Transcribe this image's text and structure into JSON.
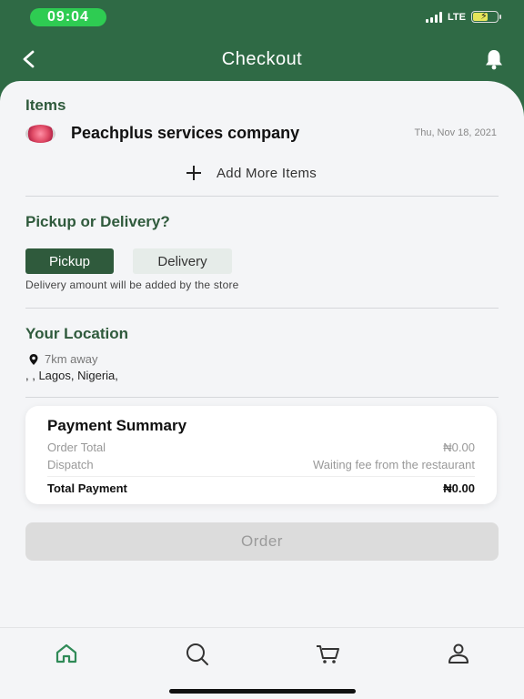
{
  "status_bar": {
    "time": "09:04",
    "network": "LTE"
  },
  "header": {
    "title": "Checkout",
    "back_icon": "chevron-left-icon",
    "bell_icon": "bell-icon"
  },
  "items_section": {
    "title": "Items",
    "company_name": "Peachplus services company",
    "date": "Thu, Nov 18, 2021",
    "add_more_label": "Add More Items"
  },
  "pickup_section": {
    "title": "Pickup or Delivery?",
    "pickup_label": "Pickup",
    "delivery_label": "Delivery",
    "selected": "Pickup",
    "note": "Delivery amount will be added by the store"
  },
  "location_section": {
    "title": "Your Location",
    "distance": "7km away",
    "address": ", , Lagos, Nigeria,"
  },
  "payment_summary": {
    "title": "Payment Summary",
    "order_total_label": "Order Total",
    "order_total_value": "₦0.00",
    "dispatch_label": "Dispatch",
    "dispatch_value": "Waiting fee from the restaurant",
    "total_label": "Total Payment",
    "total_value": "₦0.00"
  },
  "order_button": {
    "label": "Order",
    "state": "disabled"
  },
  "bottom_nav": {
    "items": [
      "home-icon",
      "search-icon",
      "cart-icon",
      "profile-icon"
    ],
    "active": "home-icon"
  },
  "colors": {
    "brand_green": "#2f6a45",
    "dark_green": "#2f5a3c",
    "time_pill": "#2ecc52",
    "background": "#f4f5f7"
  }
}
